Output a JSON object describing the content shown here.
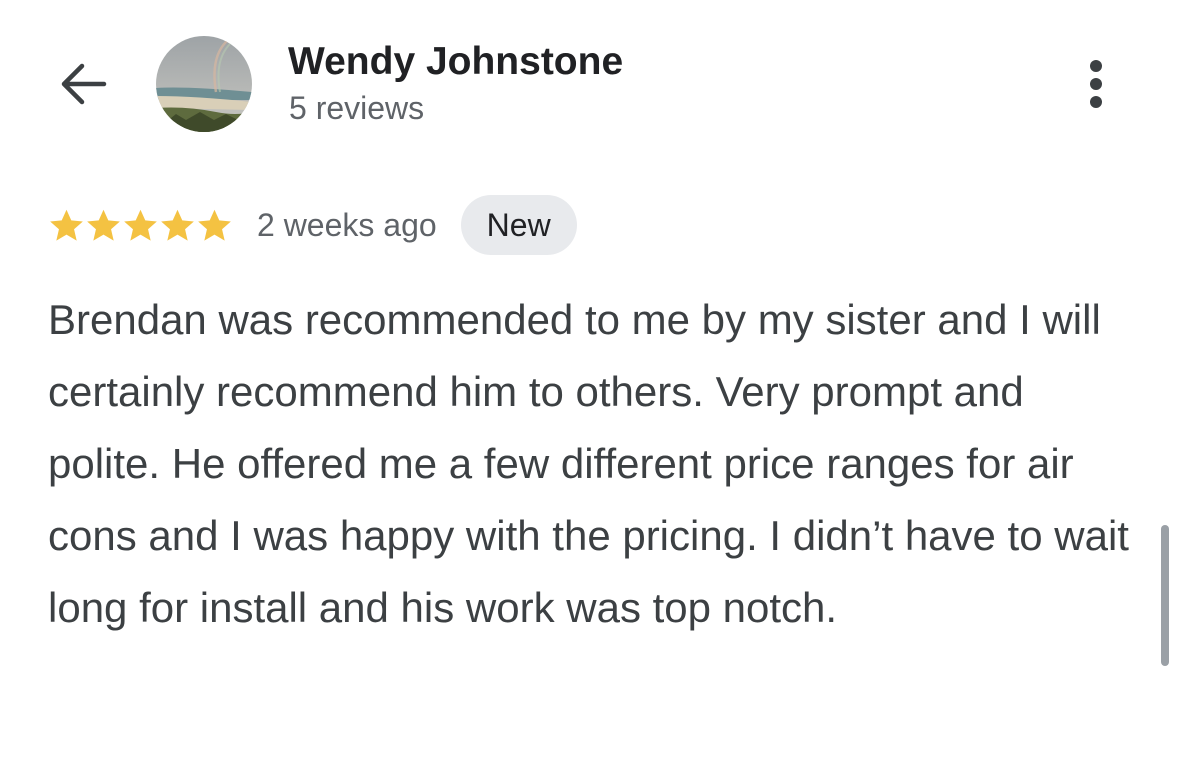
{
  "header": {
    "back_icon": "arrow-left-icon",
    "reviewer_name": "Wendy Johnstone",
    "review_count": "5 reviews",
    "avatar": "profile-photo-beach-rainbow",
    "more_icon": "more-vertical-icon"
  },
  "review": {
    "rating": 5,
    "rating_max": 5,
    "star_color": "#F4C242",
    "time": "2 weeks ago",
    "badge": "New",
    "text": "Brendan was recommended to me by my sister and I will certainly recommend him to others. Very prompt and polite. He offered me a few different price ranges for air cons and I was happy with the pricing. I didn’t have to wait long for install and his work was top notch."
  }
}
